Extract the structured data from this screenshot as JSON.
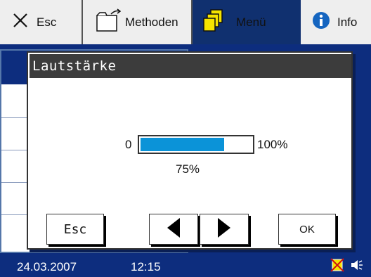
{
  "toolbar": {
    "esc_label": "Esc",
    "methods_label": "Methoden",
    "menu_label": "Menü",
    "info_label": "Info",
    "icons": {
      "esc": "close-x-icon",
      "methods": "folder-icon",
      "menu": "stacked-folders-icon",
      "info": "info-icon"
    }
  },
  "dialog": {
    "title": "Lautstärke",
    "volume": {
      "min_label": "0",
      "max_label": "100%",
      "value_label": "75%",
      "fraction": 0.75
    },
    "buttons": {
      "esc_label": "Esc",
      "ok_label": "OK",
      "left_icon": "triangle-left-icon",
      "right_icon": "triangle-right-icon"
    }
  },
  "status_bar": {
    "date": "24.03.2007",
    "time": "12:15",
    "icons": [
      "card-disabled-icon",
      "speaker-icon"
    ]
  },
  "colors": {
    "background_blue": "#0d2d7e",
    "menu_tab": "#10306f",
    "dialog_title": "#3c3c3c",
    "volume_fill": "#0b93d8",
    "info_blue": "#1565c0",
    "folder_yellow": "#f5e400"
  }
}
